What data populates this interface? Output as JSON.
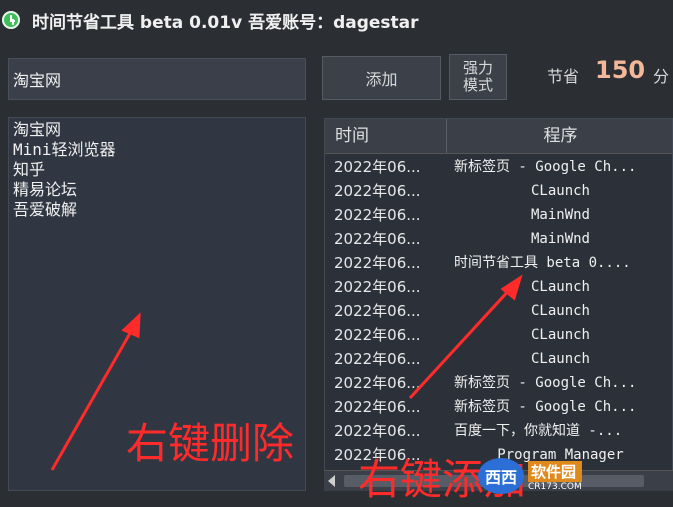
{
  "window": {
    "title": "时间节省工具 beta 0.01v  吾爱账号：dagestar"
  },
  "input": {
    "value": "淘宝网"
  },
  "buttons": {
    "add": "添加",
    "force_mode": "强力模式"
  },
  "saved": {
    "label": "节省",
    "value": "150",
    "unit": "分"
  },
  "site_list": [
    "淘宝网",
    "Mini轻浏览器",
    "知乎",
    "精易论坛",
    "吾爱破解"
  ],
  "table": {
    "headers": {
      "time": "时间",
      "program": "程序"
    },
    "rows": [
      {
        "time": "2022年06...",
        "program": "新标签页 - Google Ch..."
      },
      {
        "time": "2022年06...",
        "program": "CLaunch"
      },
      {
        "time": "2022年06...",
        "program": "MainWnd"
      },
      {
        "time": "2022年06...",
        "program": "MainWnd"
      },
      {
        "time": "2022年06...",
        "program": "时间节省工具 beta 0...."
      },
      {
        "time": "2022年06...",
        "program": "CLaunch"
      },
      {
        "time": "2022年06...",
        "program": "CLaunch"
      },
      {
        "time": "2022年06...",
        "program": "CLaunch"
      },
      {
        "time": "2022年06...",
        "program": "CLaunch"
      },
      {
        "time": "2022年06...",
        "program": "新标签页 - Google Ch..."
      },
      {
        "time": "2022年06...",
        "program": "新标签页 - Google Ch..."
      },
      {
        "time": "2022年06...",
        "program": "百度一下，你就知道 -..."
      },
      {
        "time": "2022年06...",
        "program": "Program Manager"
      }
    ]
  },
  "annotations": {
    "delete": "右键删除",
    "add": "右键添加"
  },
  "watermark": {
    "logo": "西西",
    "name": "软件园",
    "url": "CR173.COM"
  },
  "colors": {
    "background": "#2b2e33",
    "accent_value": "#f3b89a",
    "annotation": "#ff2b2b",
    "app_icon": "#3fbf5b"
  },
  "icons": {
    "app": "clock-icon",
    "scroll_left": "left-arrow-icon"
  }
}
